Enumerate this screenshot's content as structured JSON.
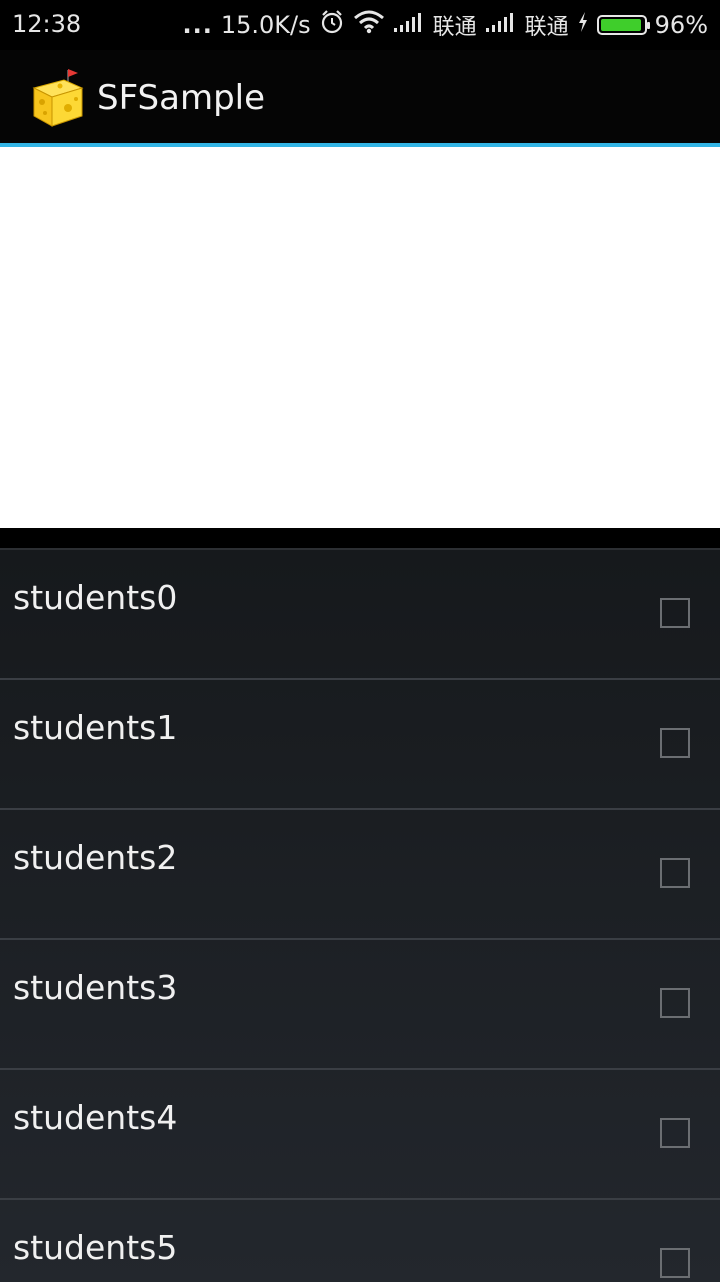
{
  "status_bar": {
    "time": "12:38",
    "dots": "...",
    "speed": "15.0K/s",
    "alarm_icon": "alarm-icon",
    "wifi_icon": "wifi-icon",
    "carrier1": "联通",
    "carrier2": "联通",
    "battery_percent": "96%",
    "battery_level": 0.96,
    "battery_color": "#3fce2b"
  },
  "action_bar": {
    "title": "SFSample",
    "icon": "cheese-app-icon",
    "accent": "#33b5e5"
  },
  "list": {
    "items": [
      {
        "label": "students0",
        "checked": false
      },
      {
        "label": "students1",
        "checked": false
      },
      {
        "label": "students2",
        "checked": false
      },
      {
        "label": "students3",
        "checked": false
      },
      {
        "label": "students4",
        "checked": false
      },
      {
        "label": "students5",
        "checked": false
      }
    ]
  }
}
